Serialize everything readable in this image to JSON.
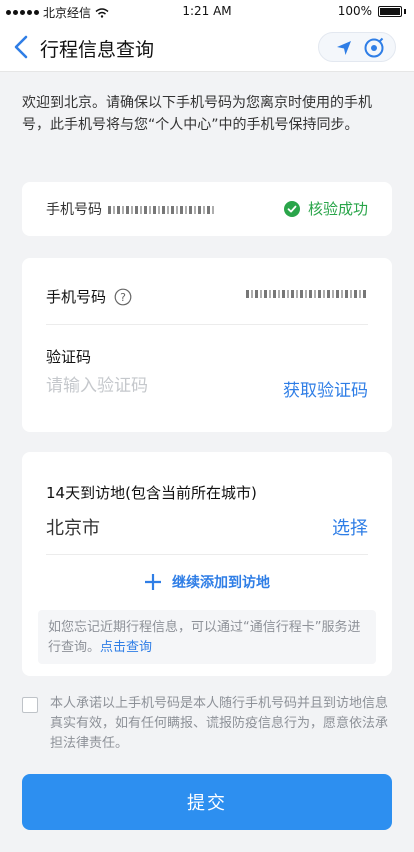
{
  "status_bar": {
    "carrier": "北京经信",
    "time": "1:21 AM",
    "battery": "100%"
  },
  "nav": {
    "title": "行程信息查询"
  },
  "intro": {
    "text": "欢迎到北京。请确保以下手机号码为您离京时使用的手机号，此手机号将与您“个人中心”中的手机号保持同步。"
  },
  "verify_card": {
    "label": "手机号码",
    "status": "核验成功"
  },
  "phone_card": {
    "phone_label": "手机号码",
    "code_label": "验证码",
    "code_placeholder": "请输入验证码",
    "code_value": "",
    "get_code": "获取验证码"
  },
  "visit_card": {
    "title": "14天到访地(包含当前所在城市)",
    "city": "北京市",
    "select": "选择",
    "add": "继续添加到访地",
    "tip": "如您忘记近期行程信息，可以通过“通信行程卡”服务进行查询。",
    "tip_link": "点击查询"
  },
  "promise": {
    "text": "本人承诺以上手机号码是本人随行手机号码并且到访地信息真实有效，如有任何瞒报、谎报防疫信息行为，愿意依法承担法律责任。"
  },
  "submit": {
    "label": "提交"
  },
  "colors": {
    "accent": "#2f7ee6",
    "button": "#2d8ff0",
    "success": "#2aa54a"
  },
  "icons": [
    "back-chevron-icon",
    "location-arrow-icon",
    "close-circle-icon",
    "check-circle-icon",
    "help-icon",
    "plus-icon",
    "wifi-icon",
    "battery-icon"
  ]
}
